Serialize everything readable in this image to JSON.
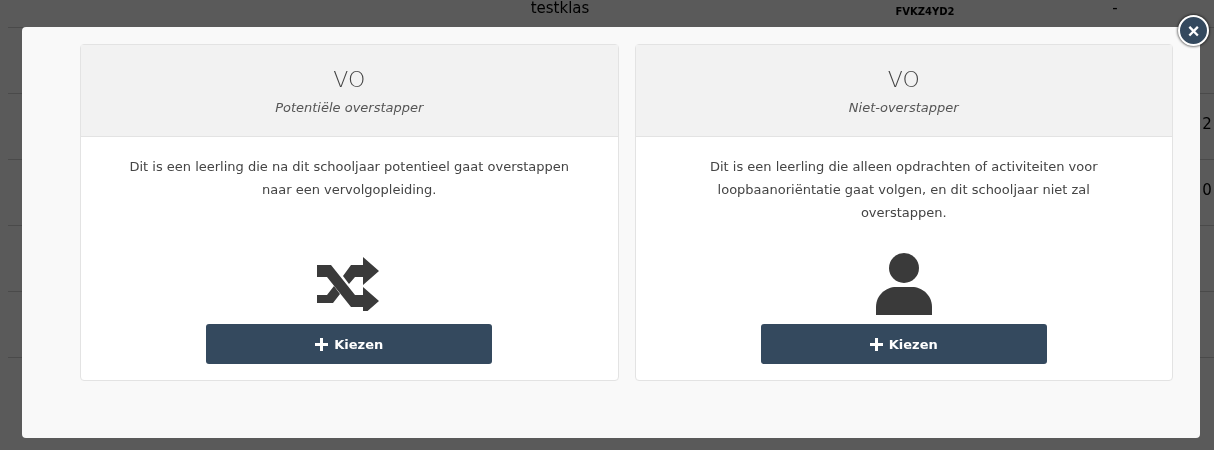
{
  "background_table": {
    "rows": [
      {
        "cells": [
          "",
          "testklas",
          "FVKZ4YD2",
          "-",
          ""
        ]
      },
      {
        "cells": [
          "",
          "",
          "",
          "",
          ""
        ]
      },
      {
        "cells": [
          "",
          "",
          "",
          "",
          "2"
        ]
      },
      {
        "cells": [
          "",
          "",
          "",
          "",
          "0"
        ]
      },
      {
        "cells": [
          "",
          "",
          "",
          "",
          ""
        ]
      },
      {
        "cells": [
          "",
          "",
          "",
          "",
          ""
        ]
      }
    ]
  },
  "modal": {
    "close": "×",
    "options": [
      {
        "kind": "shuffle",
        "title": "VO",
        "subtitle": "Potentiële overstapper",
        "description": "Dit is een leerling die na dit schooljaar potentieel gaat overstappen naar een vervolgopleiding.",
        "button": "Kiezen"
      },
      {
        "kind": "person",
        "title": "VO",
        "subtitle": "Niet-overstapper",
        "description": "Dit is een leerling die alleen opdrachten of activiteiten voor loopbaanoriëntatie gaat volgen, en dit schooljaar niet zal overstappen.",
        "button": "Kiezen"
      }
    ]
  }
}
